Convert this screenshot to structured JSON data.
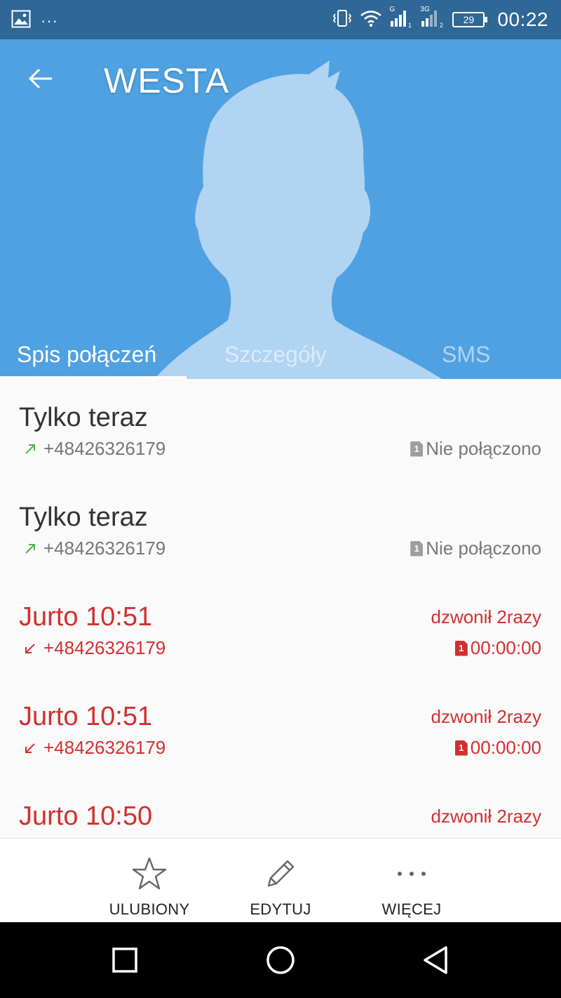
{
  "status_bar": {
    "time": "00:22",
    "battery": "29",
    "icons": [
      "image-icon",
      "more-dots-icon",
      "vibrate-icon",
      "wifi-icon",
      "signal-sim1-icon",
      "signal-sim2-icon",
      "battery-icon"
    ],
    "dots": "···",
    "sim1_network": "G",
    "sim2_network": "3G"
  },
  "header": {
    "contact_name": "WESTA",
    "background_color": "#4fa1e1",
    "tabs": [
      {
        "label": "Spis połączeń",
        "active": true
      },
      {
        "label": "Szczegóły",
        "active": false
      },
      {
        "label": "SMS",
        "active": false
      }
    ]
  },
  "calls": [
    {
      "title": "Tylko teraz",
      "number": "+48426326179",
      "direction": "outgoing",
      "status": "Nie połączono",
      "missed": false
    },
    {
      "title": "Tylko teraz",
      "number": "+48426326179",
      "direction": "outgoing",
      "status": "Nie połączono",
      "missed": false
    },
    {
      "title": "Jurto 10:51",
      "number": "+48426326179",
      "direction": "incoming",
      "note": "dzwonił 2razy",
      "duration": "00:00:00",
      "missed": true
    },
    {
      "title": "Jurto 10:51",
      "number": "+48426326179",
      "direction": "incoming",
      "note": "dzwonił 2razy",
      "duration": "00:00:00",
      "missed": true
    },
    {
      "title": "Jurto 10:50",
      "note": "dzwonił 2razy",
      "missed": true
    }
  ],
  "sim_label": "1",
  "actions": {
    "favorite": "ULUBIONY",
    "edit": "EDYTUJ",
    "more": "WIĘCEJ"
  },
  "colors": {
    "status_bar": "#2f6796",
    "accent": "#4fa1e1",
    "missed": "#d32f2f",
    "outgoing_arrow": "#4caf50"
  }
}
